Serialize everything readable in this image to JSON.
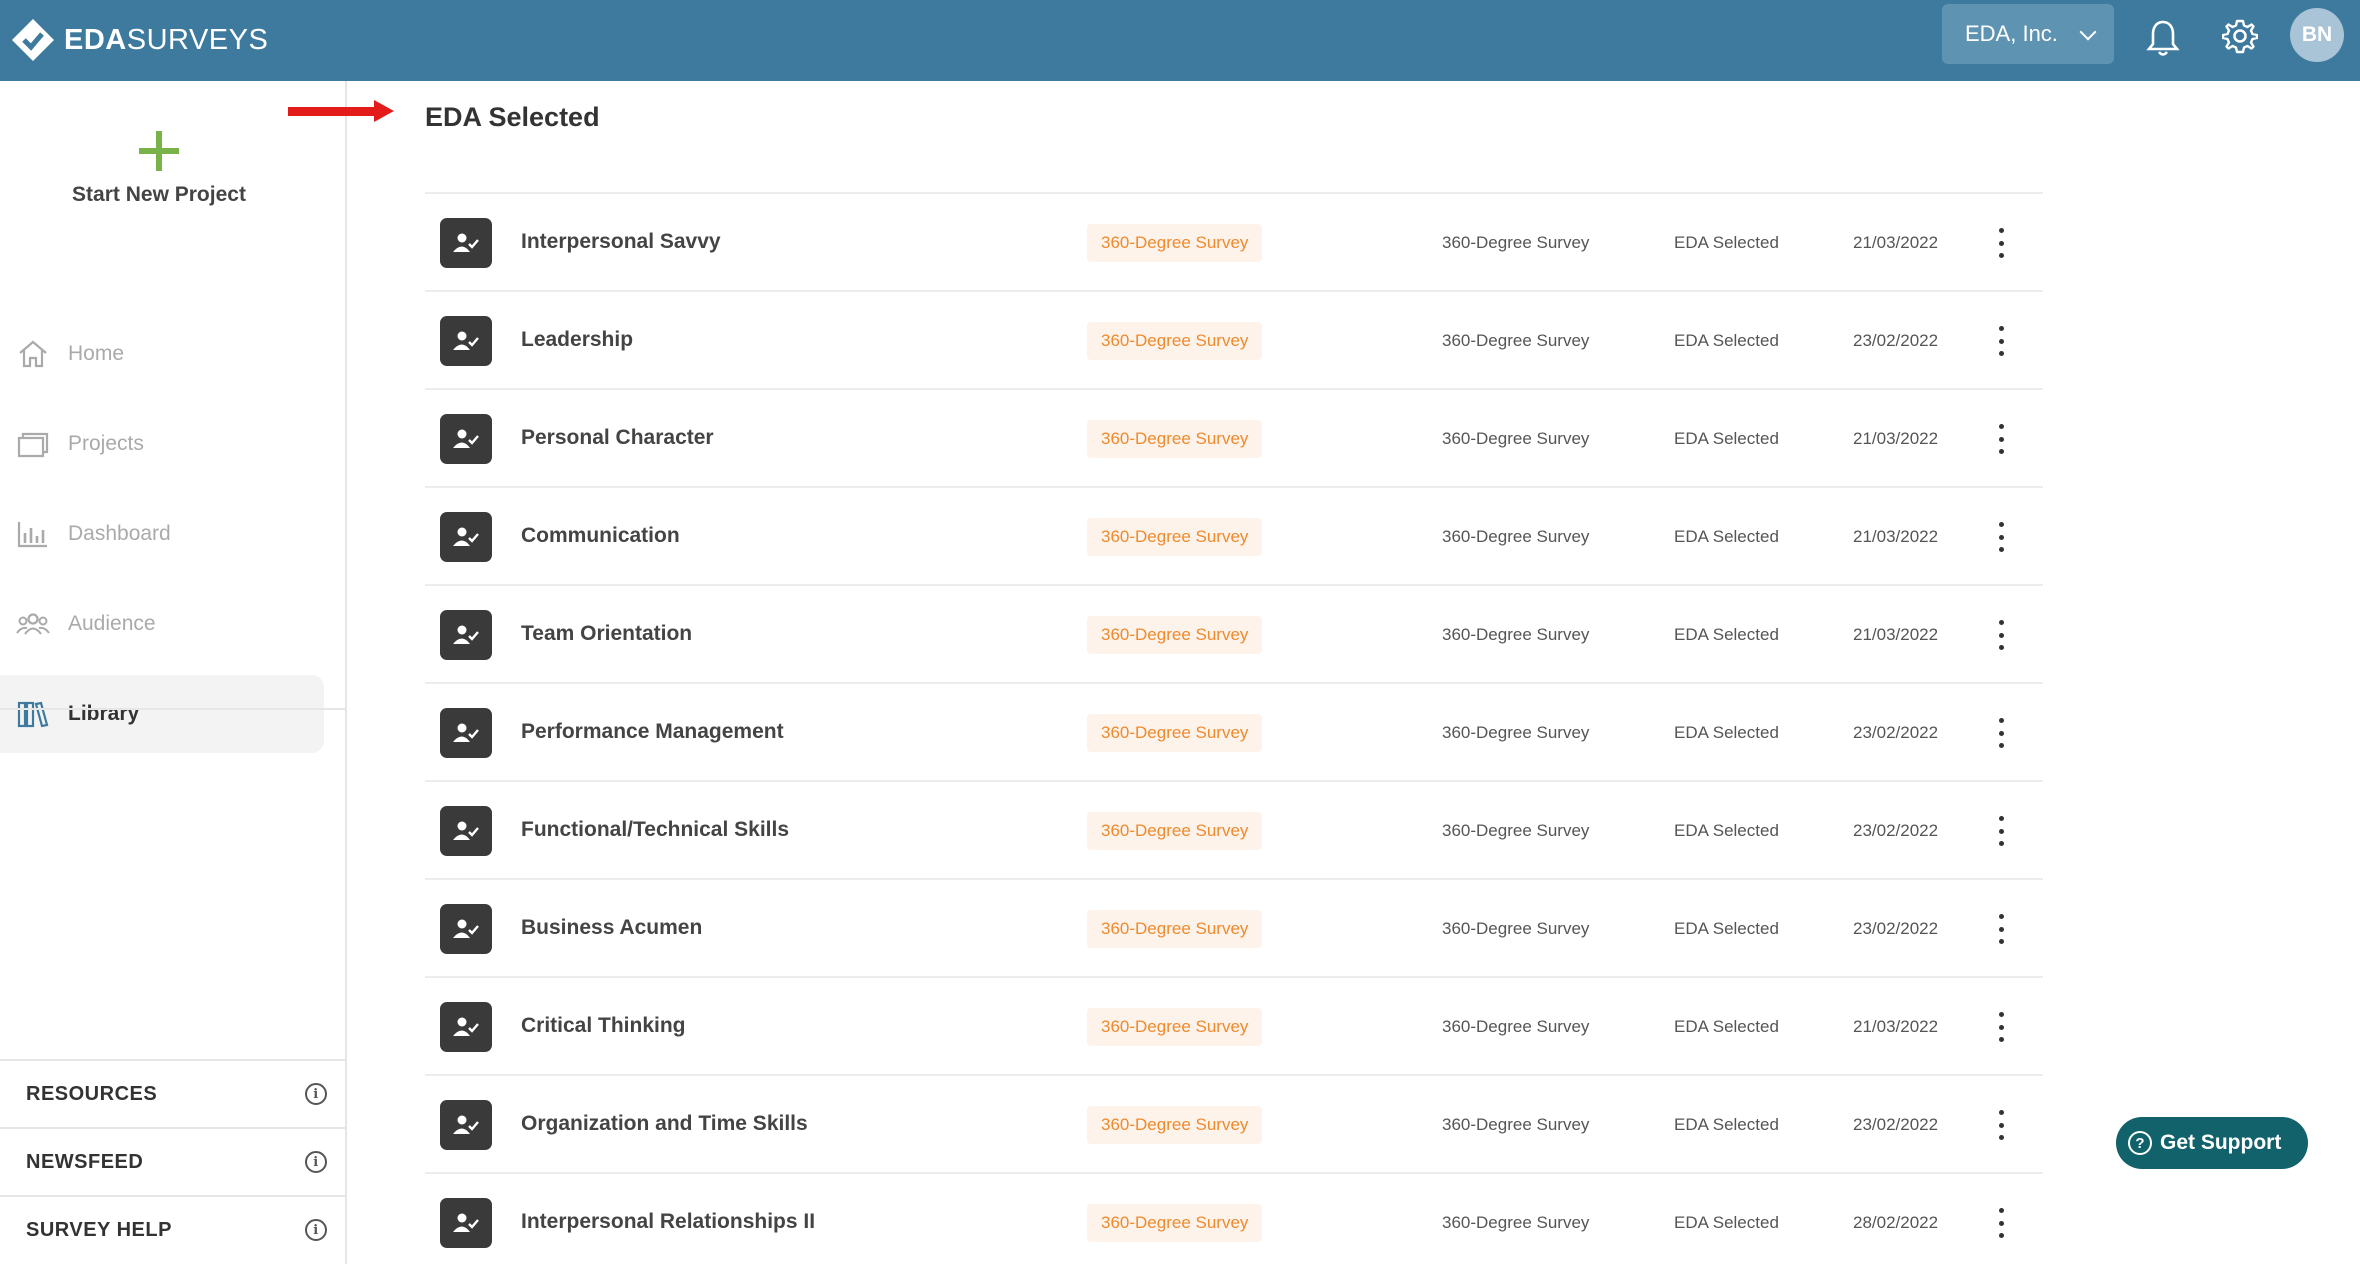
{
  "header": {
    "logo_bold": "EDA",
    "logo_rest": "SURVEYS",
    "org_select": "EDA, Inc.",
    "avatar_initials": "BN"
  },
  "sidebar": {
    "new_project_label": "Start New Project",
    "items": [
      {
        "label": "Home",
        "icon": "home-icon"
      },
      {
        "label": "Projects",
        "icon": "folder-icon"
      },
      {
        "label": "Dashboard",
        "icon": "bar-chart-icon"
      },
      {
        "label": "Audience",
        "icon": "people-icon"
      },
      {
        "label": "Library",
        "icon": "library-icon",
        "active": true
      }
    ],
    "links": [
      {
        "label": "RESOURCES"
      },
      {
        "label": "NEWSFEED"
      },
      {
        "label": "SURVEY HELP"
      }
    ],
    "info_glyph": "i"
  },
  "main": {
    "title": "EDA Selected",
    "rows": [
      {
        "name": "Interpersonal Savvy",
        "tag": "360-Degree Survey",
        "type": "360-Degree Survey",
        "source": "EDA Selected",
        "date": "21/03/2022"
      },
      {
        "name": "Leadership",
        "tag": "360-Degree Survey",
        "type": "360-Degree Survey",
        "source": "EDA Selected",
        "date": "23/02/2022"
      },
      {
        "name": "Personal Character",
        "tag": "360-Degree Survey",
        "type": "360-Degree Survey",
        "source": "EDA Selected",
        "date": "21/03/2022"
      },
      {
        "name": "Communication",
        "tag": "360-Degree Survey",
        "type": "360-Degree Survey",
        "source": "EDA Selected",
        "date": "21/03/2022"
      },
      {
        "name": "Team Orientation",
        "tag": "360-Degree Survey",
        "type": "360-Degree Survey",
        "source": "EDA Selected",
        "date": "21/03/2022"
      },
      {
        "name": "Performance Management",
        "tag": "360-Degree Survey",
        "type": "360-Degree Survey",
        "source": "EDA Selected",
        "date": "23/02/2022"
      },
      {
        "name": "Functional/Technical Skills",
        "tag": "360-Degree Survey",
        "type": "360-Degree Survey",
        "source": "EDA Selected",
        "date": "23/02/2022"
      },
      {
        "name": "Business Acumen",
        "tag": "360-Degree Survey",
        "type": "360-Degree Survey",
        "source": "EDA Selected",
        "date": "23/02/2022"
      },
      {
        "name": "Critical Thinking",
        "tag": "360-Degree Survey",
        "type": "360-Degree Survey",
        "source": "EDA Selected",
        "date": "21/03/2022"
      },
      {
        "name": "Organization and Time Skills",
        "tag": "360-Degree Survey",
        "type": "360-Degree Survey",
        "source": "EDA Selected",
        "date": "23/02/2022"
      },
      {
        "name": "Interpersonal Relationships II",
        "tag": "360-Degree Survey",
        "type": "360-Degree Survey",
        "source": "EDA Selected",
        "date": "28/02/2022"
      }
    ]
  },
  "support_button": {
    "label": "Get Support",
    "glyph": "?"
  },
  "colors": {
    "topbar": "#3d7a9e",
    "accent_green": "#7ab24a",
    "tag_orange": "#ef8a2d",
    "support": "#12626b",
    "arrow_red": "#e31b1b"
  }
}
